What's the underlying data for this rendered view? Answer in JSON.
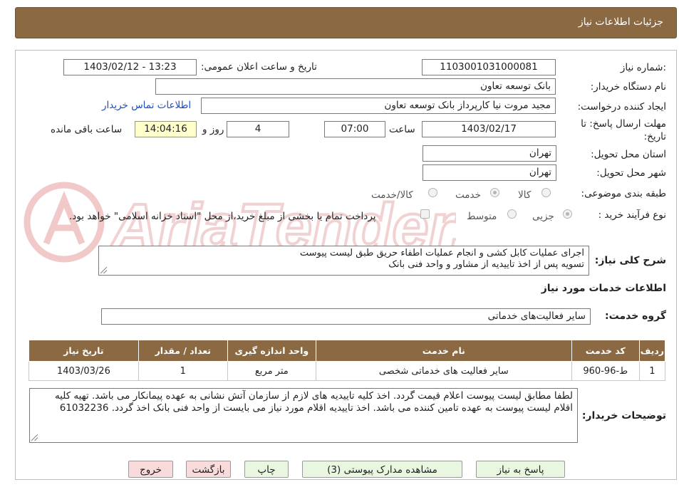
{
  "header": {
    "title": "جزئیات اطلاعات نیاز"
  },
  "form": {
    "need_number_label": "شماره نیاز:",
    "need_number": "1103001031000081",
    "announce_label": "تاریخ و ساعت اعلان عمومی:",
    "announce_value": "1403/02/12 - 13:23",
    "buyer_org_label": "نام دستگاه خریدار:",
    "buyer_org": "بانک توسعه تعاون",
    "creator_label": "ایجاد کننده درخواست:",
    "creator": "مجید مروت نیا کارپرداز بانک توسعه تعاون",
    "contact_link": "اطلاعات تماس خریدار",
    "deadline_label_1": "مهلت ارسال پاسخ: تا",
    "deadline_label_2": "تاریخ:",
    "deadline_date": "1403/02/17",
    "time_label": "ساعت",
    "deadline_time": "07:00",
    "days_value": "4",
    "days_label": "روز و",
    "remaining_time": "14:04:16",
    "remaining_label": "ساعت باقی مانده",
    "province_label": "استان محل تحویل:",
    "province": "تهران",
    "city_label": "شهر محل تحویل:",
    "city": "تهران",
    "category_label": "طبقه بندی موضوعی:",
    "category_options": [
      "کالا",
      "خدمت",
      "کالا/خدمت"
    ],
    "process_label": "نوع فرآیند خرید :",
    "process_options": [
      "جزیی",
      "متوسط"
    ],
    "payment_note": "پرداخت تمام یا بخشی از مبلغ خرید،از محل \"اسناد خزانه اسلامی\" خواهد بود.",
    "summary_label": "شرح کلی نیاز:",
    "summary_line1": "اجرای عملیات کابل کشی و انجام عملیات اطفاء حریق طبق لیست پیوست",
    "summary_line2": "تسویه پس از اخذ تاییدیه از مشاور و واحد فنی بانک"
  },
  "services": {
    "section_title": "اطلاعات خدمات مورد نیاز",
    "group_label": "گروه خدمت:",
    "group_value": "سایر فعالیت‌های خدماتی",
    "columns": [
      "ردیف",
      "کد خدمت",
      "نام خدمت",
      "واحد اندازه گیری",
      "تعداد / مقدار",
      "تاریخ نیاز"
    ],
    "rows": [
      [
        "1",
        "ط-96-960",
        "سایر فعالیت های خدماتی شخصی",
        "متر مربع",
        "1",
        "1403/03/26"
      ]
    ]
  },
  "buyer_notes": {
    "label": "توضیحات خریدار:",
    "text": "لطفا مطابق لیست پیوست اعلام قیمت گردد. اخذ کلیه تاییدیه های لازم از سازمان آتش نشانی به عهده پیمانکار می باشد. تهیه کلیه اقلام لیست پیوست به عهده تامین کننده می باشد. اخذ تاییدیه اقلام مورد نیاز می بایست از واحد فنی بانک اخذ گردد. 61032236"
  },
  "buttons": {
    "reply": "پاسخ به نیاز",
    "attachments": "مشاهده مدارک پیوستی (3)",
    "print": "چاپ",
    "back": "بازگشت",
    "exit": "خروج"
  },
  "watermark": {
    "text": "AriaTender.net"
  },
  "colors": {
    "header_bg": "#8b6a43",
    "button_green": "#eaf7e0",
    "button_pink": "#fadbdb",
    "remaining_bg": "#ffffcc"
  }
}
